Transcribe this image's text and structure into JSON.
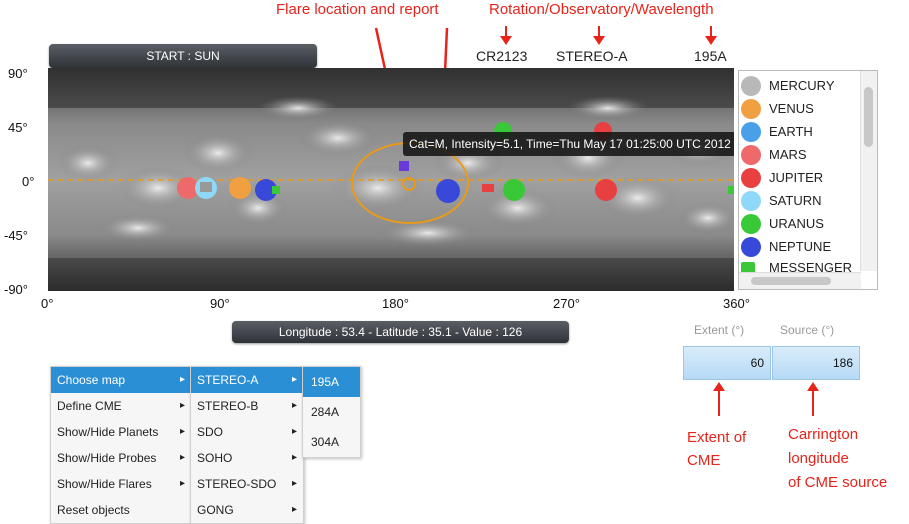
{
  "annotations": {
    "flare": "Flare location and report",
    "rotation": "Rotation/Observatory/Wavelength",
    "extent": [
      "Extent of",
      "CME"
    ],
    "carrington": [
      "Carrington",
      "longitude",
      "of CME source"
    ]
  },
  "start_button": "START : SUN",
  "observation": {
    "rotation": "CR2123",
    "observatory": "STEREO-A",
    "wavelength": "195A"
  },
  "axes": {
    "y_ticks": [
      "90°",
      "45°",
      "0°",
      "-45°",
      "-90°"
    ],
    "x_ticks": [
      "0°",
      "90°",
      "180°",
      "270°",
      "360°"
    ]
  },
  "tooltip": "Cat=M, Intensity=5.1, Time=Thu May 17 01:25:00 UTC 2012",
  "status_readout": "Longitude : 53.4 - Latitude : 35.1 - Value : 126",
  "planet_list": [
    {
      "label": "MERCURY",
      "color": "#b8b8b8"
    },
    {
      "label": "VENUS",
      "color": "#f0a040"
    },
    {
      "label": "EARTH",
      "color": "#4aa0e8"
    },
    {
      "label": "MARS",
      "color": "#ee6a6a"
    },
    {
      "label": "JUPITER",
      "color": "#e84040"
    },
    {
      "label": "SATURN",
      "color": "#8fd8f8"
    },
    {
      "label": "URANUS",
      "color": "#38c838"
    },
    {
      "label": "NEPTUNE",
      "color": "#3848d8"
    },
    {
      "label": "MESSENGER",
      "color": "#38c838"
    }
  ],
  "menu": {
    "col1": [
      "Choose map",
      "Define CME",
      "Show/Hide Planets",
      "Show/Hide Probes",
      "Show/Hide Flares",
      "Reset objects"
    ],
    "col2": [
      "STEREO-A",
      "STEREO-B",
      "SDO",
      "SOHO",
      "STEREO-SDO",
      "GONG"
    ],
    "col3": [
      "195A",
      "284A",
      "304A"
    ]
  },
  "cme": {
    "extent_label": "Extent (°)",
    "source_label": "Source (°)",
    "extent_value": "60",
    "source_value": "186"
  },
  "colors": {
    "accent": "#2b8fd6",
    "annotation": "#e8231a",
    "ellipse": "#e89a1a"
  }
}
